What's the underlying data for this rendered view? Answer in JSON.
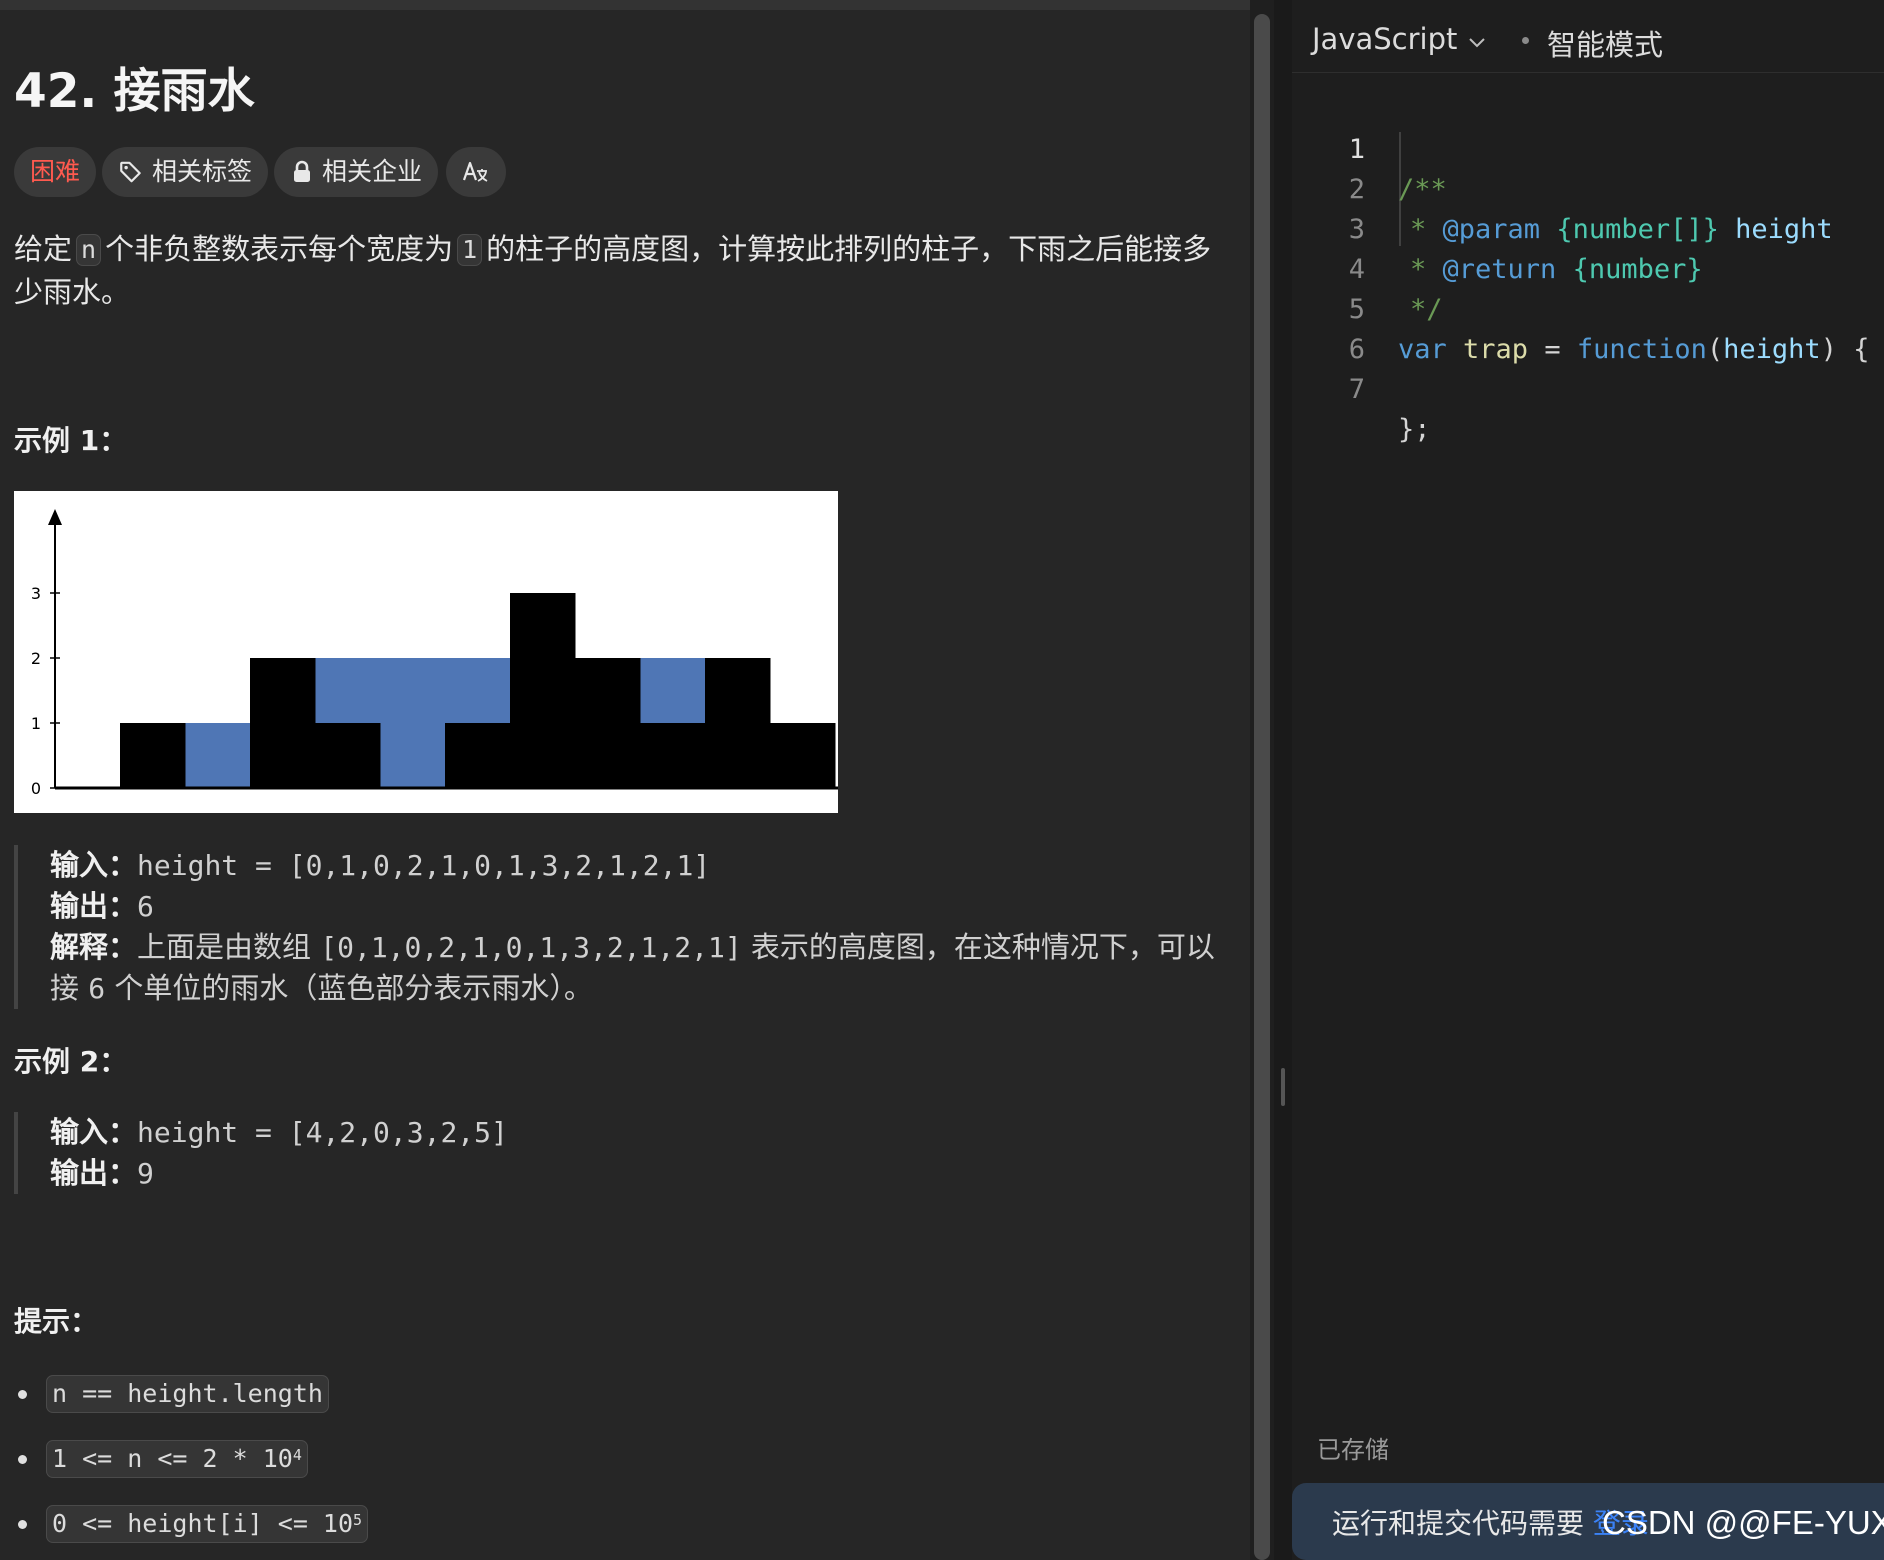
{
  "problem": {
    "title": "42. 接雨水",
    "tags": {
      "difficulty": "困难",
      "topics": "相关标签",
      "companies": "相关企业",
      "translate_icon": "translate-icon"
    },
    "description": {
      "part1": "给定",
      "code_n": "n",
      "part2": "个非负整数表示每个宽度为",
      "code_1": "1",
      "part3": "的柱子的高度图，计算按此排列的柱子，下雨之后能接多",
      "part4": "少雨水。"
    },
    "example1": {
      "heading": "示例 1：",
      "input_label": "输入：",
      "input_value": "height = [0,1,0,2,1,0,1,3,2,1,2,1]",
      "output_label": "输出：",
      "output_value": "6",
      "explain_label": "解释：",
      "explain_a": "上面是由数组",
      "explain_code": "[0,1,0,2,1,0,1,3,2,1,2,1]",
      "explain_b": "表示的高度图，在这种情况下，可以",
      "explain_c": "接",
      "explain_num": "6",
      "explain_d": "个单位的雨水（蓝色部分表示雨水）。"
    },
    "example2": {
      "heading": "示例 2：",
      "input_label": "输入：",
      "input_value": "height = [4,2,0,3,2,5]",
      "output_label": "输出：",
      "output_value": "9"
    },
    "hints": {
      "heading": "提示：",
      "items": [
        {
          "text": "n == height.length",
          "sup": ""
        },
        {
          "text": "1 <= n <= 2 * 10",
          "sup": "4"
        },
        {
          "text": "0 <= height[i] <= 10",
          "sup": "5"
        }
      ]
    }
  },
  "figure": {
    "heights": [
      0,
      1,
      0,
      2,
      1,
      0,
      1,
      3,
      2,
      1,
      2,
      1
    ],
    "water": [
      0,
      0,
      1,
      0,
      1,
      2,
      1,
      0,
      0,
      1,
      0,
      0
    ],
    "y_ticks": [
      "0",
      "1",
      "2",
      "3"
    ],
    "colors": {
      "bar": "#000000",
      "water": "#4f76b5",
      "background": "#ffffff"
    }
  },
  "editor": {
    "language": "JavaScript",
    "mode": "智能模式",
    "line_numbers": [
      "1",
      "2",
      "3",
      "4",
      "5",
      "6",
      "7"
    ],
    "code": {
      "l1": "/**",
      "l2_star": "* ",
      "l2_tag": "@param",
      "l2_type": " {number[]} ",
      "l2_name": "height",
      "l3_star": "* ",
      "l3_tag": "@return",
      "l3_type": " {number}",
      "l4": "*/",
      "l5_var": "var",
      "l5_name": " trap",
      "l5_eq": " = ",
      "l5_fn": "function",
      "l5_open": "(",
      "l5_param": "height",
      "l5_close": ") {",
      "l7": "};"
    },
    "saved_status": "已存储",
    "login_prompt": "运行和提交代码需要",
    "login_link": "登录",
    "watermark": "CSDN @@FE-YUX"
  }
}
